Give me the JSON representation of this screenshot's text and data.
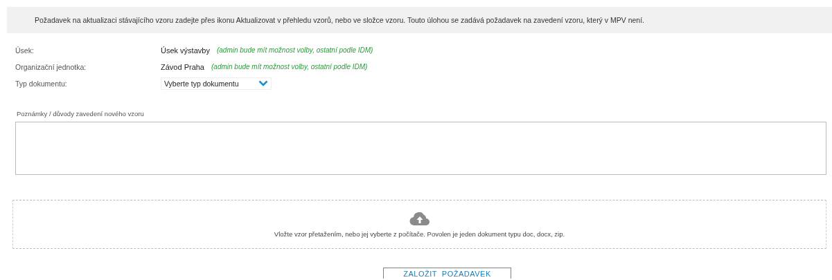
{
  "notice": "Požadavek na aktualizaci stávajícího vzoru zadejte přes ikonu Aktualizovat v přehledu vzorů, nebo ve složce vzoru. Touto úlohou se zadává požadavek na zavedení vzoru, který v MPV není.",
  "fields": [
    {
      "kind": "text",
      "label": "Úsek:",
      "value": "Úsek výstavby",
      "hint": "(admin bude mít možnost volby, ostatní podle IDM)"
    },
    {
      "kind": "text",
      "label": "Organizační jednotka:",
      "value": "Závod Praha",
      "hint": "(admin bude mít možnost volby, ostatní podle IDM)"
    },
    {
      "kind": "select",
      "label": "Typ dokumentu:",
      "placeholder": "Vyberte typ dokumentu"
    }
  ],
  "notes": {
    "label": "Poznámky / důvody zavedení nového vzoru"
  },
  "dropzone": {
    "text": "Vložte vzor přetažením, nebo jej vyberte z počítače. Povolen je jeden dokument typu doc, docx, zip."
  },
  "submit": {
    "label": "ZALOŽIT  POŽADAVEK"
  }
}
